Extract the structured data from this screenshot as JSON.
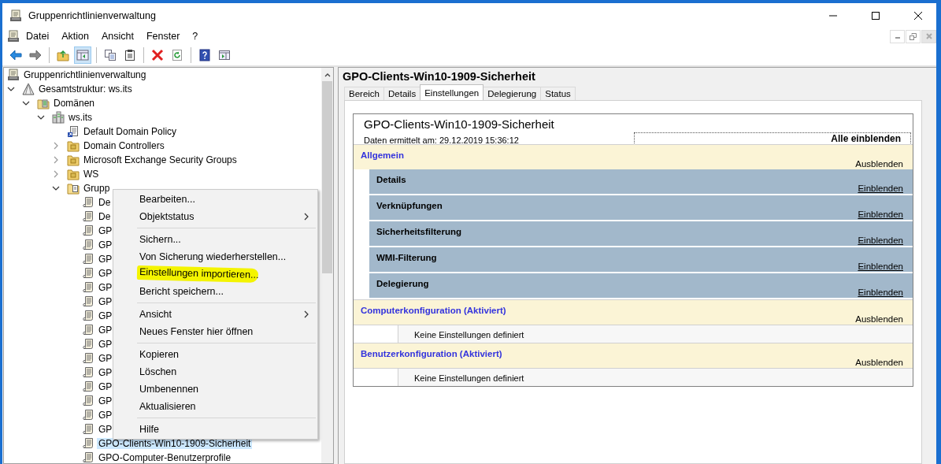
{
  "window": {
    "title": "Gruppenrichtlinienverwaltung"
  },
  "menu_bar": [
    "Datei",
    "Aktion",
    "Ansicht",
    "Fenster",
    "?"
  ],
  "toolbar": [
    {
      "kind": "back",
      "pressed": false
    },
    {
      "kind": "forward",
      "pressed": false
    },
    {
      "kind": "sep"
    },
    {
      "kind": "up",
      "pressed": false
    },
    {
      "kind": "tree",
      "pressed": true
    },
    {
      "kind": "sep"
    },
    {
      "kind": "copy",
      "pressed": false
    },
    {
      "kind": "paste",
      "pressed": false
    },
    {
      "kind": "sep"
    },
    {
      "kind": "delete",
      "pressed": false
    },
    {
      "kind": "refresh",
      "pressed": false
    },
    {
      "kind": "sep"
    },
    {
      "kind": "help",
      "pressed": false
    },
    {
      "kind": "view",
      "pressed": false
    }
  ],
  "tree": [
    {
      "label": "Gruppenrichtlinienverwaltung",
      "kind": "console",
      "selected": false,
      "children": [
        {
          "label": "Gesamtstruktur: ws.its",
          "kind": "forest",
          "expanded": true,
          "selected": false,
          "children": [
            {
              "label": "Domänen",
              "kind": "domains",
              "expanded": true,
              "selected": false,
              "children": [
                {
                  "label": "ws.its",
                  "kind": "domain",
                  "expanded": true,
                  "selected": false,
                  "children": [
                    {
                      "label": "Default Domain Policy",
                      "kind": "gpo-link",
                      "selected": false
                    },
                    {
                      "label": "Domain Controllers",
                      "kind": "ou",
                      "expanded": false,
                      "selected": false
                    },
                    {
                      "label": "Microsoft Exchange Security Groups",
                      "kind": "ou",
                      "expanded": false,
                      "selected": false
                    },
                    {
                      "label": "WS",
                      "kind": "ou",
                      "expanded": false,
                      "selected": false
                    },
                    {
                      "label": "Grupp",
                      "kind": "gpo-folder",
                      "expanded": true,
                      "selected": false,
                      "children": [
                        {
                          "label": "De",
                          "kind": "gpo",
                          "selected": false
                        },
                        {
                          "label": "De",
                          "kind": "gpo",
                          "selected": false
                        },
                        {
                          "label": "GP",
                          "kind": "gpo",
                          "selected": false
                        },
                        {
                          "label": "GP",
                          "kind": "gpo",
                          "selected": false
                        },
                        {
                          "label": "GP",
                          "kind": "gpo",
                          "selected": false
                        },
                        {
                          "label": "GP",
                          "kind": "gpo",
                          "selected": false
                        },
                        {
                          "label": "GP",
                          "kind": "gpo",
                          "selected": false
                        },
                        {
                          "label": "GP",
                          "kind": "gpo",
                          "selected": false
                        },
                        {
                          "label": "GP",
                          "kind": "gpo",
                          "selected": false
                        },
                        {
                          "label": "GP",
                          "kind": "gpo",
                          "selected": false
                        },
                        {
                          "label": "GP",
                          "kind": "gpo",
                          "selected": false
                        },
                        {
                          "label": "GP",
                          "kind": "gpo",
                          "selected": false
                        },
                        {
                          "label": "GP",
                          "kind": "gpo",
                          "selected": false
                        },
                        {
                          "label": "GP",
                          "kind": "gpo",
                          "selected": false
                        },
                        {
                          "label": "GP",
                          "kind": "gpo",
                          "selected": false
                        },
                        {
                          "label": "GP",
                          "kind": "gpo",
                          "selected": false
                        },
                        {
                          "label": "GP",
                          "kind": "gpo",
                          "selected": false
                        },
                        {
                          "label": "GPO-Clients-Win10-1909-Sicherheit",
                          "kind": "gpo",
                          "selected": true
                        },
                        {
                          "label": "GPO-Computer-Benutzerprofile",
                          "kind": "gpo",
                          "selected": false
                        }
                      ]
                    }
                  ]
                }
              ]
            }
          ]
        }
      ]
    }
  ],
  "context_menu": [
    [
      {
        "label": "Bearbeiten...",
        "submenu": false,
        "marked": false
      },
      {
        "label": "Objektstatus",
        "submenu": true,
        "marked": false
      }
    ],
    [
      {
        "label": "Sichern...",
        "submenu": false,
        "marked": false
      },
      {
        "label": "Von Sicherung wiederherstellen...",
        "submenu": false,
        "marked": false
      },
      {
        "label": "Einstellungen importieren...",
        "submenu": false,
        "marked": true
      },
      {
        "label": "Bericht speichern...",
        "submenu": false,
        "marked": false
      }
    ],
    [
      {
        "label": "Ansicht",
        "submenu": true,
        "marked": false
      },
      {
        "label": "Neues Fenster hier öffnen",
        "submenu": false,
        "marked": false
      }
    ],
    [
      {
        "label": "Kopieren",
        "submenu": false,
        "marked": false
      },
      {
        "label": "Löschen",
        "submenu": false,
        "marked": false
      },
      {
        "label": "Umbenennen",
        "submenu": false,
        "marked": false
      },
      {
        "label": "Aktualisieren",
        "submenu": false,
        "marked": false
      }
    ],
    [
      {
        "label": "Hilfe",
        "submenu": false,
        "marked": false
      }
    ]
  ],
  "detail": {
    "title": "GPO-Clients-Win10-1909-Sicherheit",
    "tabs": [
      {
        "label": "Bereich",
        "selected": false
      },
      {
        "label": "Details",
        "selected": false
      },
      {
        "label": "Einstellungen",
        "selected": true
      },
      {
        "label": "Delegierung",
        "selected": false
      },
      {
        "label": "Status",
        "selected": false
      }
    ],
    "report": {
      "title": "GPO-Clients-Win10-1909-Sicherheit",
      "date": "Daten ermittelt am: 29.12.2019 15:36:12",
      "show_all": "Alle einblenden",
      "sections": [
        {
          "title": "Allgemein",
          "toggle": "Ausblenden",
          "subsections": [
            {
              "title": "Details",
              "toggle": "Einblenden"
            },
            {
              "title": "Verknüpfungen",
              "toggle": "Einblenden"
            },
            {
              "title": "Sicherheitsfilterung",
              "toggle": "Einblenden"
            },
            {
              "title": "WMI-Filterung",
              "toggle": "Einblenden"
            },
            {
              "title": "Delegierung",
              "toggle": "Einblenden"
            }
          ]
        },
        {
          "title": "Computerkonfiguration (Aktiviert)",
          "toggle": "Ausblenden",
          "note": "Keine Einstellungen definiert"
        },
        {
          "title": "Benutzerkonfiguration (Aktiviert)",
          "toggle": "Ausblenden",
          "note": "Keine Einstellungen definiert"
        }
      ]
    }
  }
}
